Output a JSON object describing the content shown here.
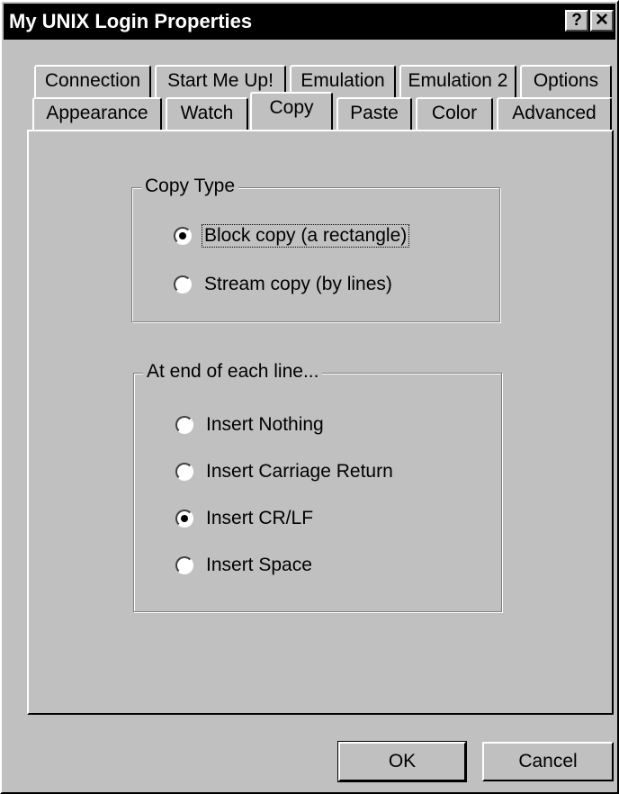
{
  "window": {
    "title": "My UNIX Login Properties",
    "help_glyph": "?",
    "close_glyph": "✕"
  },
  "tabs_row1": [
    "Connection",
    "Start Me Up!",
    "Emulation",
    "Emulation 2",
    "Options"
  ],
  "tabs_row2": [
    "Appearance",
    "Watch",
    "Copy",
    "Paste",
    "Color",
    "Advanced"
  ],
  "active_tab": "Copy",
  "copy_type": {
    "label": "Copy Type",
    "options": [
      {
        "label": "Block copy (a rectangle)",
        "selected": true
      },
      {
        "label": "Stream copy (by lines)",
        "selected": false
      }
    ]
  },
  "line_end": {
    "label": "At end of each line...",
    "options": [
      {
        "label": "Insert Nothing",
        "selected": false
      },
      {
        "label": "Insert Carriage Return",
        "selected": false
      },
      {
        "label": "Insert CR/LF",
        "selected": true
      },
      {
        "label": "Insert Space",
        "selected": false
      }
    ]
  },
  "buttons": {
    "ok": "OK",
    "cancel": "Cancel"
  }
}
